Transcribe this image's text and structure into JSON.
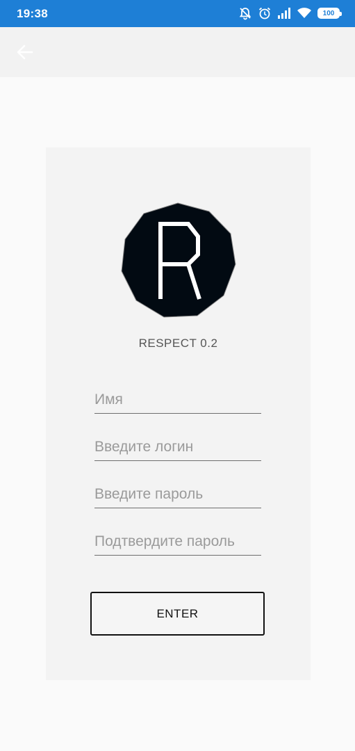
{
  "status_bar": {
    "time": "19:38",
    "icons": [
      "alarm-off-icon",
      "alarm-clock-icon",
      "signal-icon",
      "wifi-icon",
      "battery-icon"
    ],
    "battery_level": "100"
  },
  "toolbar": {
    "back_icon": "arrow-left-icon"
  },
  "logo": {
    "letter": "R"
  },
  "app_name": "RESPECT 0.2",
  "form": {
    "name_placeholder": "Имя",
    "login_placeholder": "Введите логин",
    "password_placeholder": "Введите пароль",
    "confirm_placeholder": "Подтвердите пароль",
    "enter_label": "ENTER"
  },
  "colors": {
    "status_bar": "#1e7fd6",
    "toolbar": "#f2f2f2",
    "card": "#f3f3f3",
    "logo_bg": "#020a12"
  }
}
